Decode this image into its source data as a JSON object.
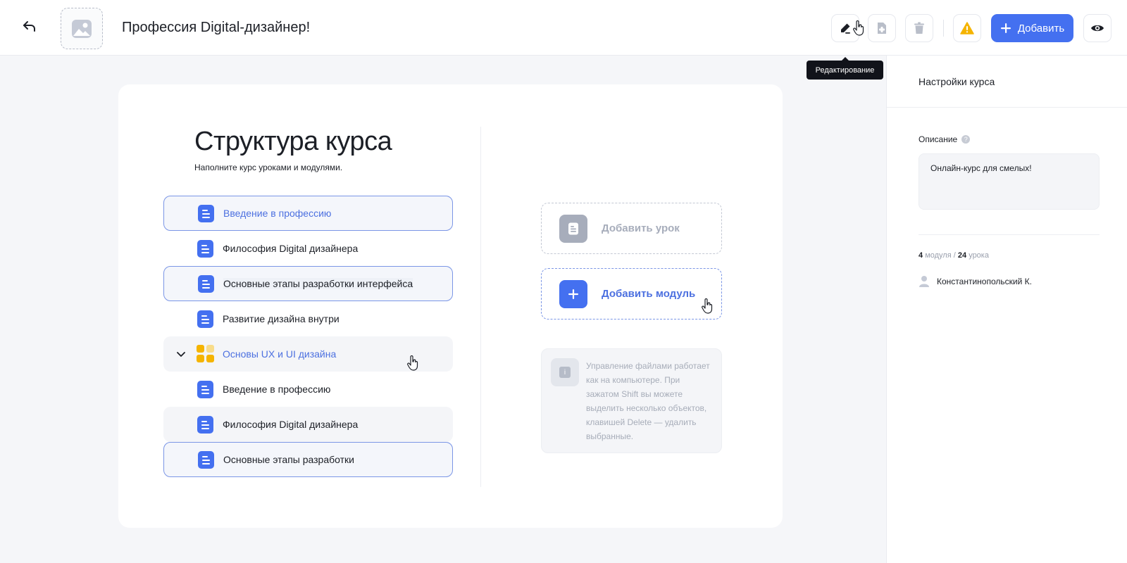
{
  "header": {
    "back_icon": "undo-arrow-icon",
    "course_title": "Профессия Digital-дизайнер!",
    "add_label": "Добавить",
    "edit_tooltip": "Редактирование",
    "icons": [
      "edit-pen-icon",
      "add-file-icon",
      "trash-icon",
      "warning-icon",
      "plus-icon",
      "eye-icon"
    ],
    "accent_color": "#4470f0",
    "warning_color": "#f5b400"
  },
  "structure": {
    "title": "Структура курса",
    "subtitle": "Наполните курс уроками и модулями.",
    "items": [
      {
        "label": "Введение в профессию",
        "type": "lesson"
      },
      {
        "label": "Философия Digital дизайнера",
        "type": "lesson"
      },
      {
        "label": "Основные этапы разработки интерфейса",
        "type": "lesson"
      },
      {
        "label": "Развитие дизайна внутри",
        "type": "lesson"
      },
      {
        "label": "Основы UX и UI дизайна",
        "type": "module"
      },
      {
        "label": "Введение в профессию",
        "type": "lesson"
      },
      {
        "label": "Философия Digital дизайнера",
        "type": "lesson"
      },
      {
        "label": "Основные этапы разработки",
        "type": "lesson"
      }
    ]
  },
  "actions": {
    "add_lesson": "Добавить урок",
    "add_module": "Добавить модуль",
    "info_text": "Управление файлами работает как на компьютере. При зажатом Shift вы можете выделить несколько объектов, клавишей Delete — удалить выбранные."
  },
  "settings": {
    "title": "Настройки курса",
    "description_label": "Описание",
    "description_help": "?",
    "description_value": "Онлайн-курс для смелых!",
    "modules_count": "4",
    "modules_word": "модуля",
    "stats_sep": "/",
    "lessons_count": "24",
    "lessons_word": "урока",
    "author": "Константинопольский К."
  }
}
